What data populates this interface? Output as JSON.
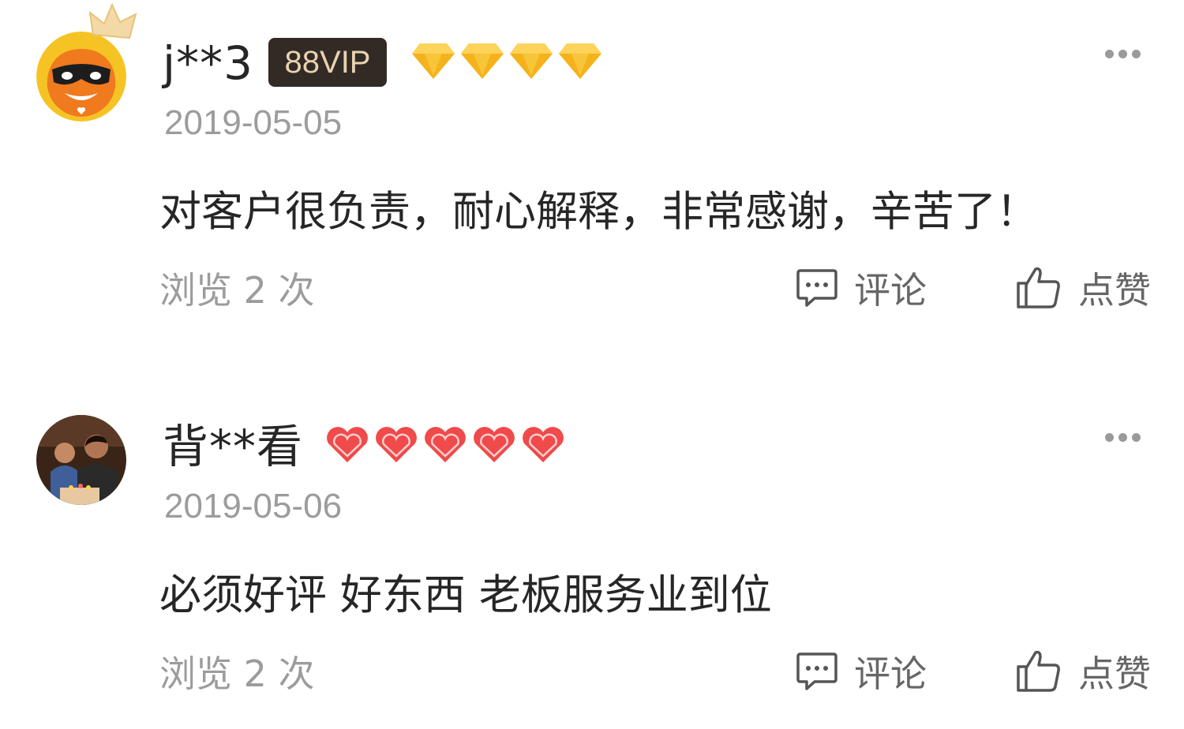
{
  "reviews": [
    {
      "username": "j**3",
      "badge": "88VIP",
      "level_icon": "diamond-icon",
      "level_count": 4,
      "date": "2019-05-05",
      "content": "对客户很负责，耐心解释，非常感谢，辛苦了！",
      "views": "浏览 2 次",
      "comment_label": "评论",
      "like_label": "点赞"
    },
    {
      "username": "背**看",
      "level_icon": "heart-icon",
      "level_count": 5,
      "date": "2019-05-06",
      "content": "必须好评 好东西 老板服务业到位",
      "views": "浏览 2 次",
      "comment_label": "评论",
      "like_label": "点赞"
    }
  ],
  "colors": {
    "diamond": "#f5b21a",
    "heart": "#f04a4a",
    "vip_bg": "#322a24",
    "vip_text": "#e9d2b0",
    "muted": "#9c9c9c"
  }
}
